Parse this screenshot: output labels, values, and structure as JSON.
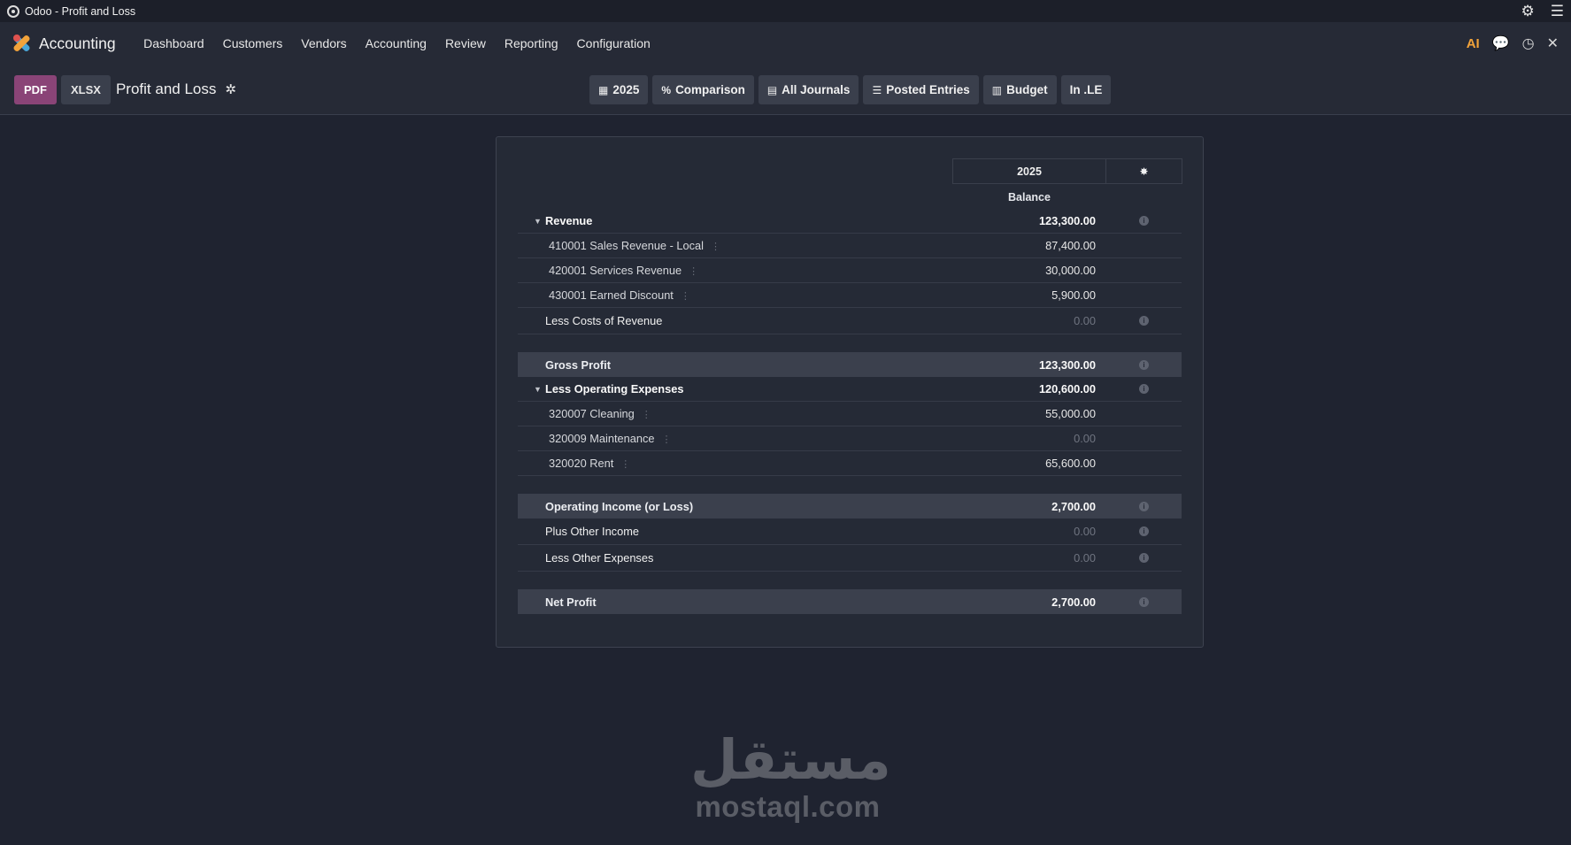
{
  "window": {
    "title": "Odoo - Profit and Loss"
  },
  "navbar": {
    "app_name": "Accounting",
    "menu": [
      "Dashboard",
      "Customers",
      "Vendors",
      "Accounting",
      "Review",
      "Reporting",
      "Configuration"
    ],
    "ai_label": "AI"
  },
  "control": {
    "pdf_label": "PDF",
    "xlsx_label": "XLSX",
    "title": "Profit and Loss",
    "filters": {
      "year": "2025",
      "comparison": "Comparison",
      "journals": "All Journals",
      "posted": "Posted Entries",
      "budget": "Budget",
      "currency": "In .LE"
    }
  },
  "report": {
    "column_year": "2025",
    "column_balance": "Balance",
    "rows": {
      "revenue": {
        "label": "Revenue",
        "amount": "123,300.00"
      },
      "r1": {
        "label": "410001 Sales Revenue - Local",
        "amount": "87,400.00"
      },
      "r2": {
        "label": "420001 Services Revenue",
        "amount": "30,000.00"
      },
      "r3": {
        "label": "430001 Earned Discount",
        "amount": "5,900.00"
      },
      "costs": {
        "label": "Less Costs of Revenue",
        "amount": "0.00"
      },
      "gross": {
        "label": "Gross Profit",
        "amount": "123,300.00"
      },
      "opex": {
        "label": "Less Operating Expenses",
        "amount": "120,600.00"
      },
      "e1": {
        "label": "320007 Cleaning",
        "amount": "55,000.00"
      },
      "e2": {
        "label": "320009 Maintenance",
        "amount": "0.00"
      },
      "e3": {
        "label": "320020 Rent",
        "amount": "65,600.00"
      },
      "opinc": {
        "label": "Operating Income (or Loss)",
        "amount": "2,700.00"
      },
      "other_inc": {
        "label": "Plus Other Income",
        "amount": "0.00"
      },
      "other_exp": {
        "label": "Less Other Expenses",
        "amount": "0.00"
      },
      "net": {
        "label": "Net Profit",
        "amount": "2,700.00"
      }
    }
  },
  "watermark": {
    "arabic": "مستقل",
    "url": "mostaql.com"
  }
}
